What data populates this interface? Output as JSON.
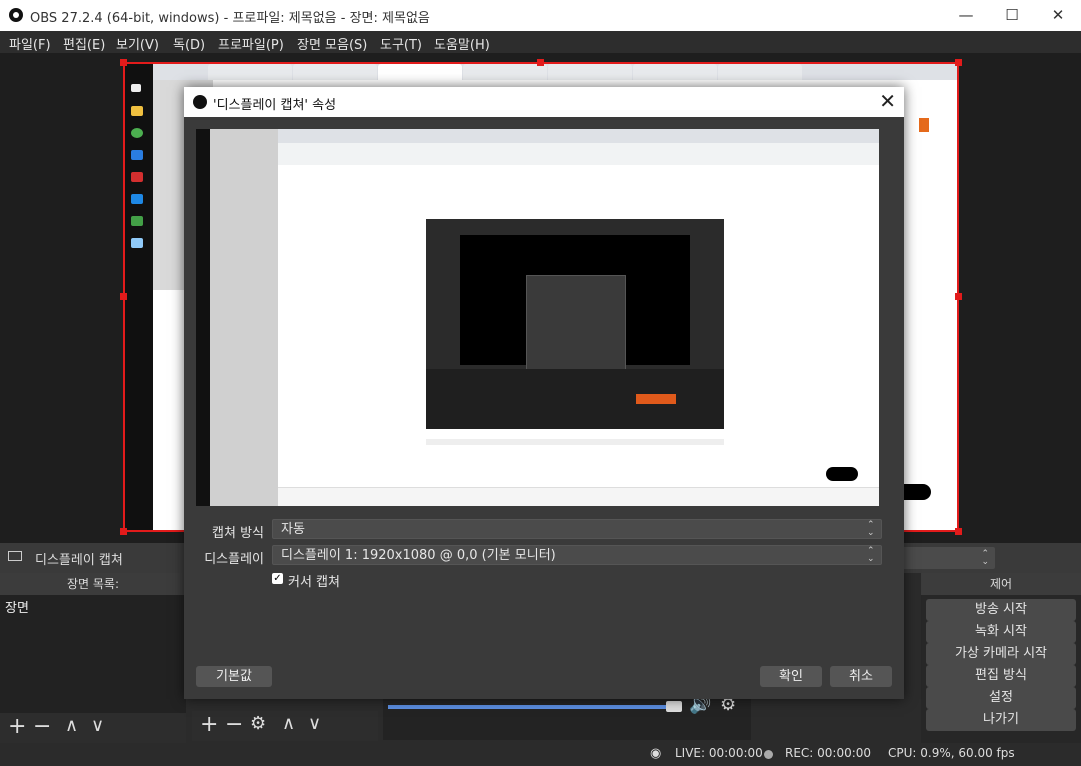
{
  "window": {
    "title": "OBS 27.2.4 (64-bit, windows) - 프로파일: 제목없음 - 장면: 제목없음",
    "minimize": "—",
    "maximize": "☐",
    "close": "✕"
  },
  "menu": [
    "파일(F)",
    "편집(E)",
    "보기(V)",
    "독(D)",
    "프로파일(P)",
    "장면 모음(S)",
    "도구(T)",
    "도움말(H)"
  ],
  "source_bar": {
    "label": "디스플레이 캡쳐"
  },
  "scenes_dock": {
    "title": "장면 목록:",
    "items": [
      "장면"
    ]
  },
  "controls_dock": {
    "title": "제어",
    "buttons": [
      "방송 시작",
      "녹화 시작",
      "가상 카메라 시작",
      "편집 방식",
      "설정",
      "나가기"
    ]
  },
  "status": {
    "live": "LIVE: 00:00:00",
    "rec": "REC: 00:00:00",
    "cpu": "CPU: 0.9%, 60.00 fps"
  },
  "dialog": {
    "title": "'디스플레이 캡쳐' 속성",
    "close": "✕",
    "capture_method_label": "캡쳐 방식",
    "capture_method_value": "자동",
    "display_label": "디스플레이",
    "display_value": "디스플레이 1: 1920x1080 @ 0,0 (기본 모니터)",
    "cursor_label": "커서 캡쳐",
    "cursor_checked": true,
    "defaults_button": "기본값",
    "ok_button": "확인",
    "cancel_button": "취소"
  },
  "colors": {
    "selection": "#e21b1b",
    "bg": "#2b2b2b",
    "dialog_bg": "#3a3a3a"
  }
}
